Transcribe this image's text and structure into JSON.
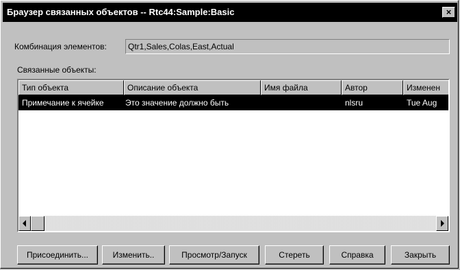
{
  "window": {
    "title": "Браузер связанных объектов  -- Rtc44:Sample:Basic",
    "close_label": "×"
  },
  "combination": {
    "label": "Комбинация элементов:",
    "value": "Qtr1,Sales,Colas,East,Actual"
  },
  "linked": {
    "label": "Связанные объекты:"
  },
  "table": {
    "columns": [
      "Тип объекта",
      "Описание объекта",
      "Имя файла",
      "Автор",
      "Изменен"
    ],
    "rows": [
      [
        "Примечание к ячейке",
        "Это значение должно быть",
        "",
        "nlsru",
        "Tue Aug"
      ]
    ]
  },
  "buttons": {
    "attach": "Присоединить...",
    "edit": "Изменить..",
    "view": "Просмотр/Запуск",
    "delete": "Стереть",
    "help": "Справка",
    "close": "Закрыть"
  },
  "icons": [
    "close-icon",
    "scroll-left-icon",
    "scroll-right-icon"
  ]
}
